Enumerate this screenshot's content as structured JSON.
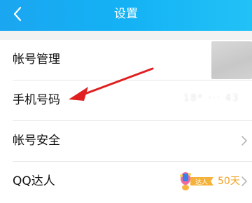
{
  "header": {
    "title": "设置",
    "back_icon": "chevron-left-icon",
    "background": "#14b2f5"
  },
  "settings": {
    "items": [
      {
        "label": "帐号管理"
      },
      {
        "label": "手机号码",
        "value": "18* ··· 43"
      },
      {
        "label": "帐号安全"
      },
      {
        "label": "QQ达人",
        "badge_text": "达人",
        "days": "50天"
      }
    ]
  },
  "annotation": {
    "arrow_color": "#e02020",
    "points_to": "手机号码"
  }
}
